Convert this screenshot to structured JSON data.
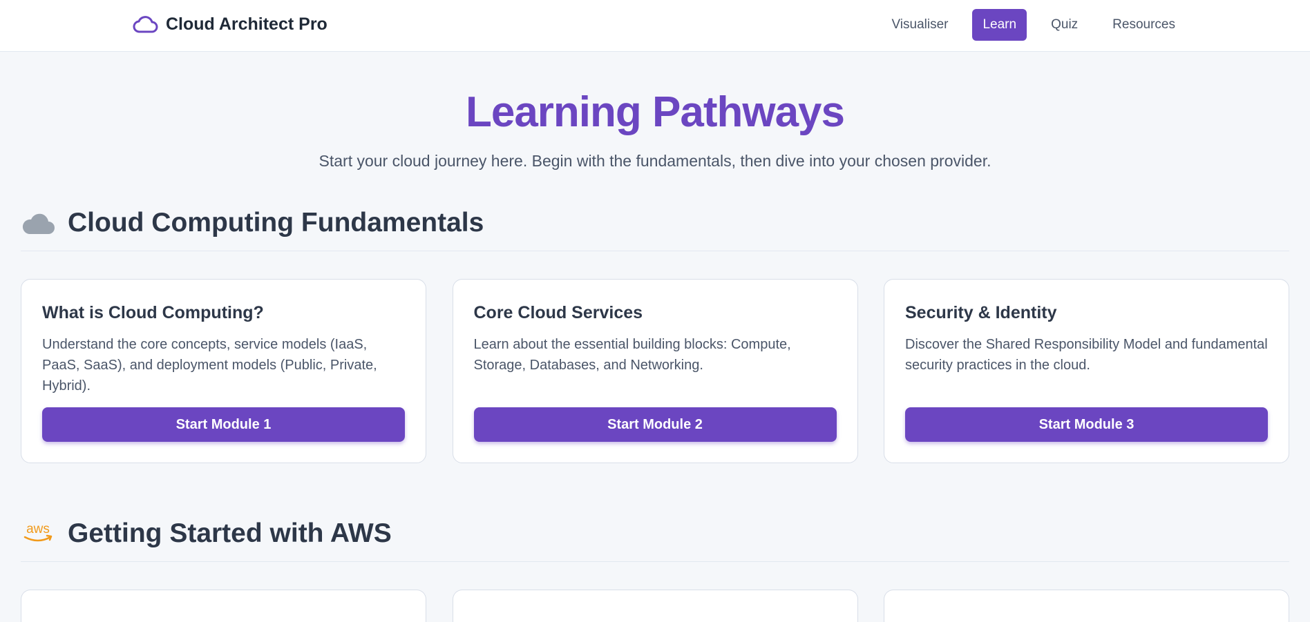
{
  "app": {
    "name": "Cloud Architect Pro"
  },
  "nav": {
    "items": [
      {
        "label": "Visualiser",
        "active": false
      },
      {
        "label": "Learn",
        "active": true
      },
      {
        "label": "Quiz",
        "active": false
      },
      {
        "label": "Resources",
        "active": false
      }
    ]
  },
  "hero": {
    "title": "Learning Pathways",
    "subtitle": "Start your cloud journey here. Begin with the fundamentals, then dive into your chosen provider."
  },
  "sections": [
    {
      "title": "Cloud Computing Fundamentals",
      "icon": "cloud-icon",
      "cards": [
        {
          "title": "What is Cloud Computing?",
          "description": "Understand the core concepts, service models (IaaS, PaaS, SaaS), and deployment models (Public, Private, Hybrid).",
          "button": "Start Module 1"
        },
        {
          "title": "Core Cloud Services",
          "description": "Learn about the essential building blocks: Compute, Storage, Databases, and Networking.",
          "button": "Start Module 2"
        },
        {
          "title": "Security & Identity",
          "description": "Discover the Shared Responsibility Model and fundamental security practices in the cloud.",
          "button": "Start Module 3"
        }
      ]
    },
    {
      "title": "Getting Started with AWS",
      "icon": "aws-logo-icon",
      "cards": []
    }
  ],
  "colors": {
    "accent": "#6b46c1",
    "background": "#f5f7fa",
    "aws_orange": "#f19a1b",
    "cloud_gray": "#9aa3ae"
  }
}
